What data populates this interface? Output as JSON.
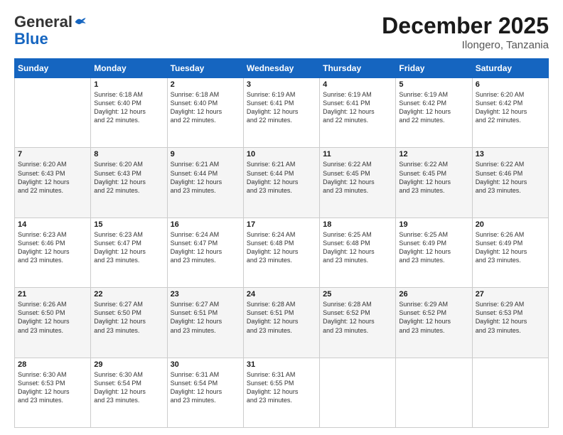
{
  "header": {
    "logo_line1": "General",
    "logo_line2": "Blue",
    "month": "December 2025",
    "location": "Ilongero, Tanzania"
  },
  "days_of_week": [
    "Sunday",
    "Monday",
    "Tuesday",
    "Wednesday",
    "Thursday",
    "Friday",
    "Saturday"
  ],
  "weeks": [
    [
      {
        "day": "",
        "info": ""
      },
      {
        "day": "1",
        "info": "Sunrise: 6:18 AM\nSunset: 6:40 PM\nDaylight: 12 hours\nand 22 minutes."
      },
      {
        "day": "2",
        "info": "Sunrise: 6:18 AM\nSunset: 6:40 PM\nDaylight: 12 hours\nand 22 minutes."
      },
      {
        "day": "3",
        "info": "Sunrise: 6:19 AM\nSunset: 6:41 PM\nDaylight: 12 hours\nand 22 minutes."
      },
      {
        "day": "4",
        "info": "Sunrise: 6:19 AM\nSunset: 6:41 PM\nDaylight: 12 hours\nand 22 minutes."
      },
      {
        "day": "5",
        "info": "Sunrise: 6:19 AM\nSunset: 6:42 PM\nDaylight: 12 hours\nand 22 minutes."
      },
      {
        "day": "6",
        "info": "Sunrise: 6:20 AM\nSunset: 6:42 PM\nDaylight: 12 hours\nand 22 minutes."
      }
    ],
    [
      {
        "day": "7",
        "info": "Sunrise: 6:20 AM\nSunset: 6:43 PM\nDaylight: 12 hours\nand 22 minutes."
      },
      {
        "day": "8",
        "info": "Sunrise: 6:20 AM\nSunset: 6:43 PM\nDaylight: 12 hours\nand 22 minutes."
      },
      {
        "day": "9",
        "info": "Sunrise: 6:21 AM\nSunset: 6:44 PM\nDaylight: 12 hours\nand 23 minutes."
      },
      {
        "day": "10",
        "info": "Sunrise: 6:21 AM\nSunset: 6:44 PM\nDaylight: 12 hours\nand 23 minutes."
      },
      {
        "day": "11",
        "info": "Sunrise: 6:22 AM\nSunset: 6:45 PM\nDaylight: 12 hours\nand 23 minutes."
      },
      {
        "day": "12",
        "info": "Sunrise: 6:22 AM\nSunset: 6:45 PM\nDaylight: 12 hours\nand 23 minutes."
      },
      {
        "day": "13",
        "info": "Sunrise: 6:22 AM\nSunset: 6:46 PM\nDaylight: 12 hours\nand 23 minutes."
      }
    ],
    [
      {
        "day": "14",
        "info": "Sunrise: 6:23 AM\nSunset: 6:46 PM\nDaylight: 12 hours\nand 23 minutes."
      },
      {
        "day": "15",
        "info": "Sunrise: 6:23 AM\nSunset: 6:47 PM\nDaylight: 12 hours\nand 23 minutes."
      },
      {
        "day": "16",
        "info": "Sunrise: 6:24 AM\nSunset: 6:47 PM\nDaylight: 12 hours\nand 23 minutes."
      },
      {
        "day": "17",
        "info": "Sunrise: 6:24 AM\nSunset: 6:48 PM\nDaylight: 12 hours\nand 23 minutes."
      },
      {
        "day": "18",
        "info": "Sunrise: 6:25 AM\nSunset: 6:48 PM\nDaylight: 12 hours\nand 23 minutes."
      },
      {
        "day": "19",
        "info": "Sunrise: 6:25 AM\nSunset: 6:49 PM\nDaylight: 12 hours\nand 23 minutes."
      },
      {
        "day": "20",
        "info": "Sunrise: 6:26 AM\nSunset: 6:49 PM\nDaylight: 12 hours\nand 23 minutes."
      }
    ],
    [
      {
        "day": "21",
        "info": "Sunrise: 6:26 AM\nSunset: 6:50 PM\nDaylight: 12 hours\nand 23 minutes."
      },
      {
        "day": "22",
        "info": "Sunrise: 6:27 AM\nSunset: 6:50 PM\nDaylight: 12 hours\nand 23 minutes."
      },
      {
        "day": "23",
        "info": "Sunrise: 6:27 AM\nSunset: 6:51 PM\nDaylight: 12 hours\nand 23 minutes."
      },
      {
        "day": "24",
        "info": "Sunrise: 6:28 AM\nSunset: 6:51 PM\nDaylight: 12 hours\nand 23 minutes."
      },
      {
        "day": "25",
        "info": "Sunrise: 6:28 AM\nSunset: 6:52 PM\nDaylight: 12 hours\nand 23 minutes."
      },
      {
        "day": "26",
        "info": "Sunrise: 6:29 AM\nSunset: 6:52 PM\nDaylight: 12 hours\nand 23 minutes."
      },
      {
        "day": "27",
        "info": "Sunrise: 6:29 AM\nSunset: 6:53 PM\nDaylight: 12 hours\nand 23 minutes."
      }
    ],
    [
      {
        "day": "28",
        "info": "Sunrise: 6:30 AM\nSunset: 6:53 PM\nDaylight: 12 hours\nand 23 minutes."
      },
      {
        "day": "29",
        "info": "Sunrise: 6:30 AM\nSunset: 6:54 PM\nDaylight: 12 hours\nand 23 minutes."
      },
      {
        "day": "30",
        "info": "Sunrise: 6:31 AM\nSunset: 6:54 PM\nDaylight: 12 hours\nand 23 minutes."
      },
      {
        "day": "31",
        "info": "Sunrise: 6:31 AM\nSunset: 6:55 PM\nDaylight: 12 hours\nand 23 minutes."
      },
      {
        "day": "",
        "info": ""
      },
      {
        "day": "",
        "info": ""
      },
      {
        "day": "",
        "info": ""
      }
    ]
  ]
}
